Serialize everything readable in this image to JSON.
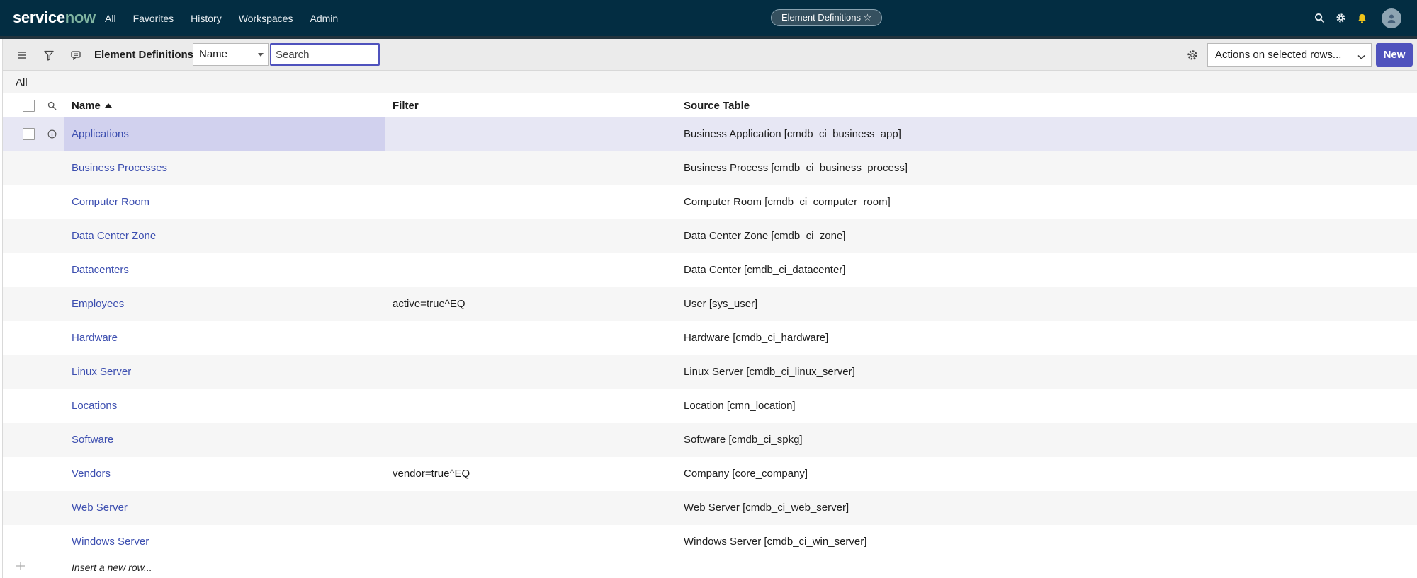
{
  "topnav": {
    "logo_service": "service",
    "logo_now": "now",
    "menu": [
      "All",
      "Favorites",
      "History",
      "Workspaces",
      "Admin"
    ],
    "context_pill": "Element Definitions ☆"
  },
  "listbar": {
    "title": "Element Definitions",
    "field_select": "Name",
    "search_placeholder": "Search",
    "actions_select": "Actions on selected rows...",
    "new_label": "New"
  },
  "breadcrumb": {
    "label": "All"
  },
  "table": {
    "columns": [
      "Name",
      "Filter",
      "Source Table"
    ],
    "rows": [
      {
        "name": "Applications",
        "filter": "",
        "source": "Business Application [cmdb_ci_business_app]"
      },
      {
        "name": "Business Processes",
        "filter": "",
        "source": "Business Process [cmdb_ci_business_process]"
      },
      {
        "name": "Computer Room",
        "filter": "",
        "source": "Computer Room [cmdb_ci_computer_room]"
      },
      {
        "name": "Data Center Zone",
        "filter": "",
        "source": "Data Center Zone [cmdb_ci_zone]"
      },
      {
        "name": "Datacenters",
        "filter": "",
        "source": "Data Center [cmdb_ci_datacenter]"
      },
      {
        "name": "Employees",
        "filter": "active=true^EQ",
        "source": "User [sys_user]"
      },
      {
        "name": "Hardware",
        "filter": "",
        "source": "Hardware [cmdb_ci_hardware]"
      },
      {
        "name": "Linux Server",
        "filter": "",
        "source": "Linux Server [cmdb_ci_linux_server]"
      },
      {
        "name": "Locations",
        "filter": "",
        "source": "Location [cmn_location]"
      },
      {
        "name": "Software",
        "filter": "",
        "source": "Software [cmdb_ci_spkg]"
      },
      {
        "name": "Vendors",
        "filter": "vendor=true^EQ",
        "source": "Company [core_company]"
      },
      {
        "name": "Web Server",
        "filter": "",
        "source": "Web Server [cmdb_ci_web_server]"
      },
      {
        "name": "Windows Server",
        "filter": "",
        "source": "Windows Server [cmdb_ci_win_server]"
      }
    ],
    "insert_row": "Insert a new row..."
  },
  "colors": {
    "nav_bg": "#032d42",
    "accent": "#4f52bd",
    "link": "#3d4fb0",
    "logo_now": "#81b5a1"
  }
}
